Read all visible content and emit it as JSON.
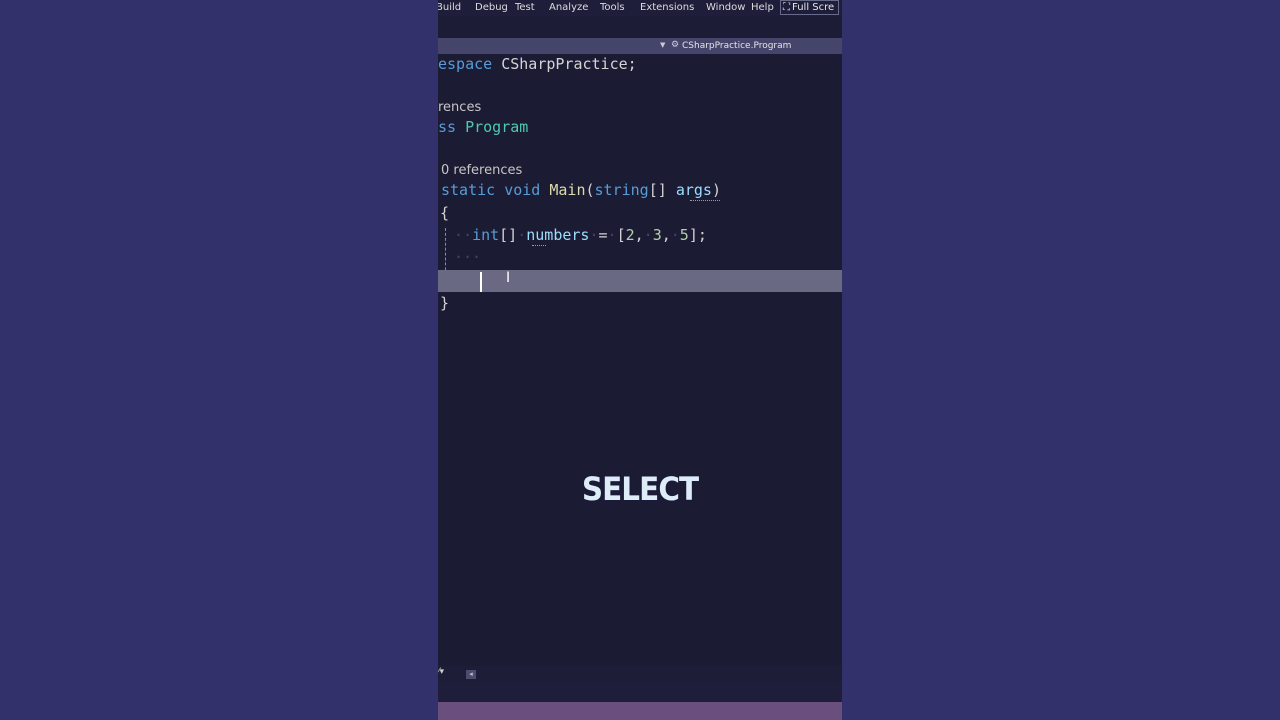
{
  "menu": {
    "items": [
      "Build",
      "Debug",
      "Test",
      "Analyze",
      "Tools",
      "Extensions",
      "Window",
      "Help"
    ],
    "fullscreen_label": "Full Scre"
  },
  "navbar": {
    "path": "CSharpPractice.Program"
  },
  "code": {
    "ns_keyword": "espace",
    "ns_name": "CSharpPractice",
    "ns_semicolon": ";",
    "class_refs": "rences",
    "class_keyword": "ss",
    "class_name": "Program",
    "method_refs": "0 references",
    "method_static": "static",
    "method_void": "void",
    "method_name": "Main",
    "method_params_open": "(",
    "method_param_type": "string",
    "method_param_brackets": "[]",
    "method_param_name": "args",
    "method_params_close": ")",
    "open_brace": "{",
    "var_type": "int",
    "var_brackets": "[]",
    "var_name": "numbers",
    "equals": "=",
    "arr_open": "[",
    "n1": "2",
    "n2": "3",
    "n3": "5",
    "arr_close": "];",
    "comma": ",",
    "close_brace": "}"
  },
  "overlay": {
    "caption": "SELECT"
  },
  "colors": {
    "background": "#32316b",
    "editor_bg": "#1c1b34",
    "current_line": "#6a6984",
    "status_bar": "#6a4f7e"
  }
}
